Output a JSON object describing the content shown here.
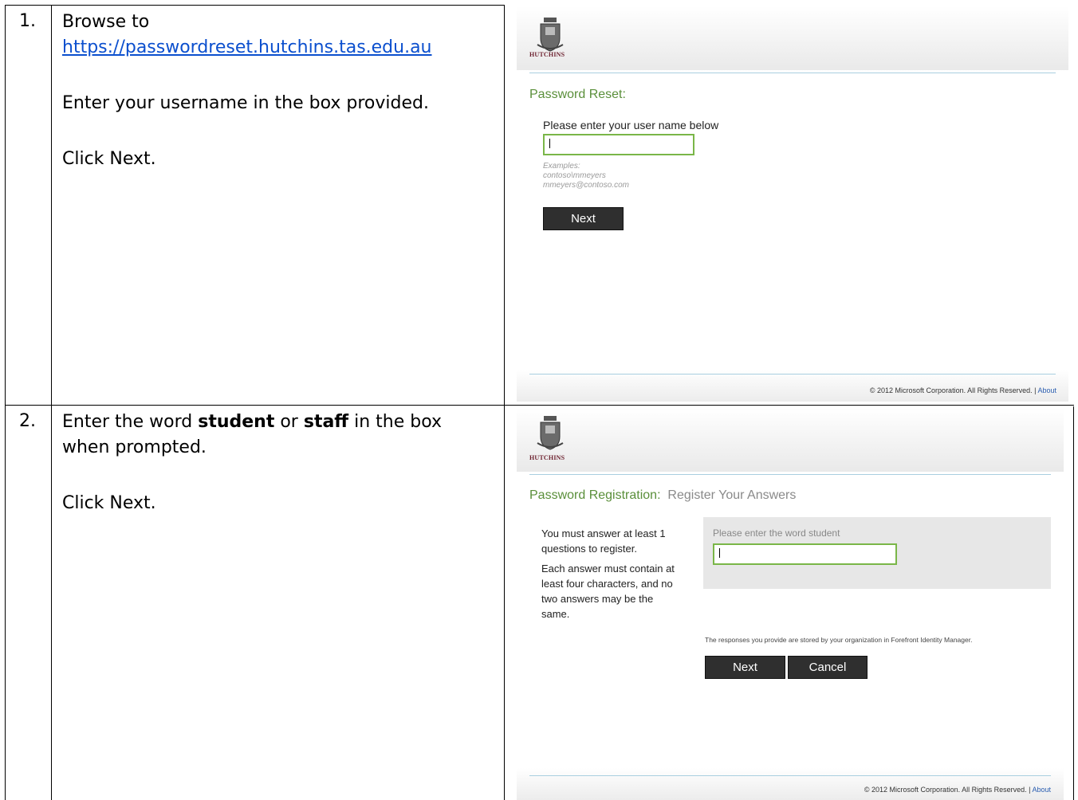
{
  "steps": [
    {
      "number": "1.",
      "line1": "Browse to",
      "link": "https://passwordreset.hutchins.tas.edu.au",
      "line2": "Enter your username in the box provided.",
      "line3": "Click Next."
    },
    {
      "number": "2.",
      "line1_pre": "Enter the word ",
      "word1": "student",
      "line1_mid": " or ",
      "word2": "staff",
      "line1_post": " in the box",
      "line1b": "when prompted.",
      "line2": "Click Next."
    }
  ],
  "shot1": {
    "logo_text": "HUTCHINS",
    "title": "Password Reset:",
    "prompt": "Please enter your user name below",
    "examples_title": "Examples:",
    "example1": "contoso\\mmeyers",
    "example2": "mmeyers@contoso.com",
    "next_label": "Next",
    "footer": "© 2012 Microsoft Corporation. All Rights Reserved.  |",
    "about": "About"
  },
  "shot2": {
    "logo_text": "HUTCHINS",
    "title": "Password Registration:",
    "subtitle": "Register Your Answers",
    "side_line1": "You must answer at least 1",
    "side_line2": "questions to register.",
    "side_line3": "Each answer must contain at",
    "side_line4": "least four characters, and no",
    "side_line5": "two answers may be the",
    "side_line6": "same.",
    "question": "Please enter the word student",
    "note": "The responses you provide are stored by your organization in Forefront Identity Manager.",
    "next_label": "Next",
    "cancel_label": "Cancel",
    "footer": "© 2012 Microsoft Corporation. All Rights Reserved.  |",
    "about": "About"
  },
  "colors": {
    "accent_green": "#5a8f3a",
    "input_border": "#7ab648",
    "button_bg": "#2f2f2f",
    "link_blue": "#0b4fce"
  }
}
